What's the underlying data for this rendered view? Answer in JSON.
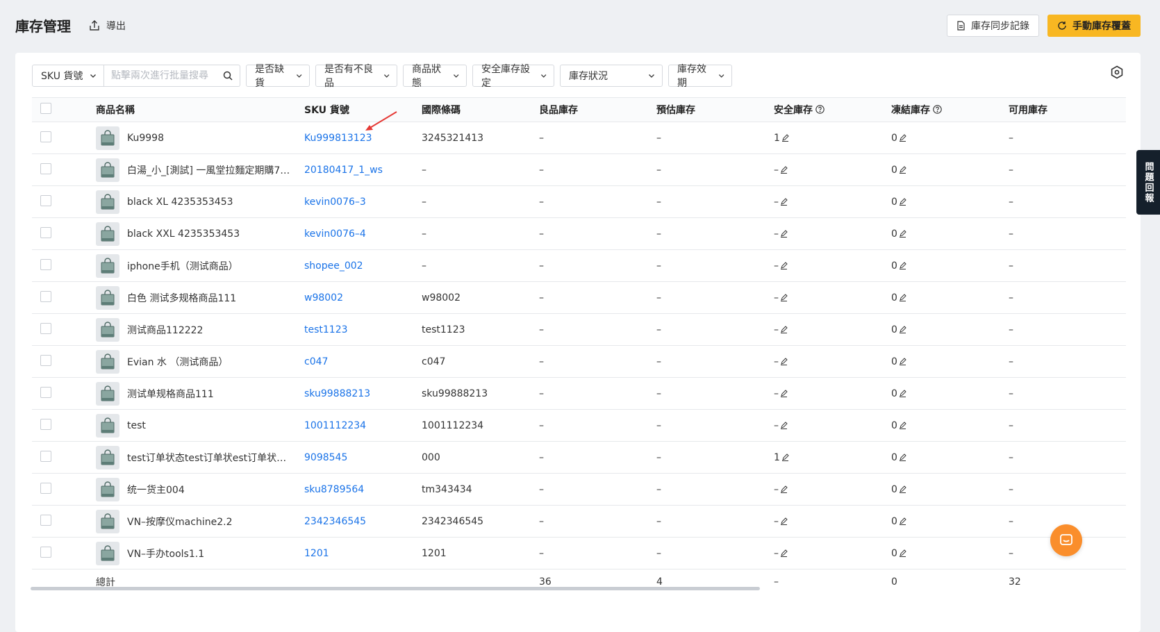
{
  "header": {
    "title": "庫存管理",
    "export_label": "導出",
    "sync_log_label": "庫存同步記錄",
    "manual_override_label": "手動庫存覆蓋"
  },
  "filters": {
    "sku_select": "SKU 貨號",
    "search_placeholder": "點擊兩次進行批量搜尋",
    "out_of_stock": "是否缺貨",
    "has_defective": "是否有不良品",
    "product_status": "商品狀態",
    "safety_setting": "安全庫存設定",
    "stock_status": "庫存狀況",
    "stock_expiry": "庫存效期"
  },
  "table": {
    "columns": {
      "name": "商品名稱",
      "sku": "SKU 貨號",
      "barcode": "國際條碼",
      "good_stock": "良品庫存",
      "estimated_stock": "預估庫存",
      "safety_stock": "安全庫存",
      "frozen_stock": "凍結庫存",
      "available_stock": "可用庫存"
    },
    "rows": [
      {
        "name": "Ku9998",
        "sku": "Ku999813123",
        "barcode": "3245321413",
        "good": "–",
        "est": "–",
        "safe": "1",
        "frozen": "0",
        "avail": "–"
      },
      {
        "name": "白湯_小_[測試] 一風堂拉麵定期購777…",
        "sku": "20180417_1_ws",
        "barcode": "–",
        "good": "–",
        "est": "–",
        "safe": "–",
        "frozen": "0",
        "avail": "–"
      },
      {
        "name": "black XL 4235353453",
        "sku": "kevin0076–3",
        "barcode": "–",
        "good": "–",
        "est": "–",
        "safe": "–",
        "frozen": "0",
        "avail": "–"
      },
      {
        "name": "black XXL 4235353453",
        "sku": "kevin0076–4",
        "barcode": "–",
        "good": "–",
        "est": "–",
        "safe": "–",
        "frozen": "0",
        "avail": "–"
      },
      {
        "name": "iphone手机（测试商品）",
        "sku": "shopee_002",
        "barcode": "–",
        "good": "–",
        "est": "–",
        "safe": "–",
        "frozen": "0",
        "avail": "–"
      },
      {
        "name": "白色 测试多规格商品111",
        "sku": "w98002",
        "barcode": "w98002",
        "good": "–",
        "est": "–",
        "safe": "–",
        "frozen": "0",
        "avail": "–"
      },
      {
        "name": "测试商品112222",
        "sku": "test1123",
        "barcode": "test1123",
        "good": "–",
        "est": "–",
        "safe": "–",
        "frozen": "0",
        "avail": "–"
      },
      {
        "name": "Evian 水 （测试商品）",
        "sku": "c047",
        "barcode": "c047",
        "good": "–",
        "est": "–",
        "safe": "–",
        "frozen": "0",
        "avail": "–"
      },
      {
        "name": "测试单规格商品111",
        "sku": "sku99888213",
        "barcode": "sku99888213",
        "good": "–",
        "est": "–",
        "safe": "–",
        "frozen": "0",
        "avail": "–"
      },
      {
        "name": "test",
        "sku": "1001112234",
        "barcode": "1001112234",
        "good": "–",
        "est": "–",
        "safe": "–",
        "frozen": "0",
        "avail": "–"
      },
      {
        "name": "test订单状态test订单状est订单状态t…",
        "sku": "9098545",
        "barcode": "000",
        "good": "–",
        "est": "–",
        "safe": "1",
        "frozen": "0",
        "avail": "–"
      },
      {
        "name": "统一货主004",
        "sku": "sku8789564",
        "barcode": "tm343434",
        "good": "–",
        "est": "–",
        "safe": "–",
        "frozen": "0",
        "avail": "–"
      },
      {
        "name": "VN–按摩仪machine2.2",
        "sku": "2342346545",
        "barcode": "2342346545",
        "good": "–",
        "est": "–",
        "safe": "–",
        "frozen": "0",
        "avail": "–"
      },
      {
        "name": "VN–手办tools1.1",
        "sku": "1201",
        "barcode": "1201",
        "good": "–",
        "est": "–",
        "safe": "–",
        "frozen": "0",
        "avail": "–"
      }
    ],
    "total": {
      "label": "總計",
      "good": "36",
      "est": "4",
      "safe": "–",
      "frozen": "0",
      "avail": "32"
    }
  },
  "feedback_tab": "問題回報",
  "colors": {
    "accent": "#f8b722",
    "link": "#1a73e8",
    "chat": "#fa8e2c"
  }
}
